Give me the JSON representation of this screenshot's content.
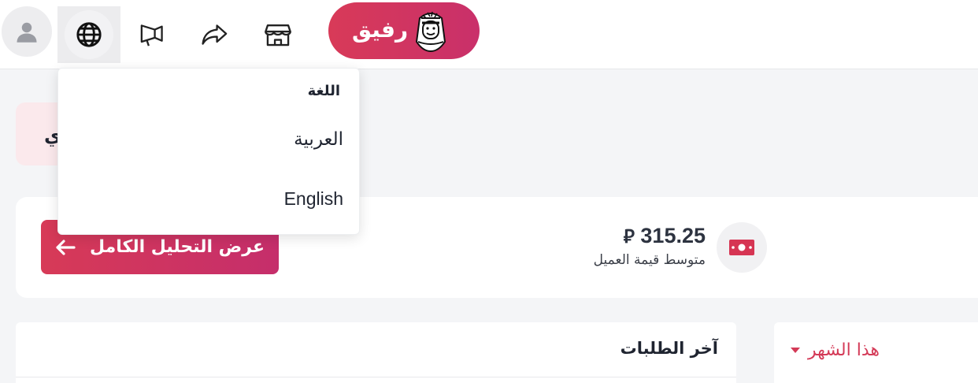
{
  "header": {
    "brand_name": "رفيق",
    "icons": {
      "avatar": "user-icon",
      "language": "globe-icon",
      "announcements": "megaphone-icon",
      "share": "share-icon",
      "store": "store-icon"
    },
    "brand_color": "#d83a58"
  },
  "language_menu": {
    "title": "اللغة",
    "options": [
      "العربية",
      "English"
    ]
  },
  "promo": {
    "visible_text": "ي"
  },
  "stats": {
    "value": "315.25",
    "currency_symbol": "⃁",
    "label": "متوسط قيمة العميل",
    "button_label": "عرض التحليل الكامل",
    "icon": "money-icon"
  },
  "orders": {
    "title": "آخر الطلبات"
  },
  "period": {
    "selected": "هذا الشهر"
  }
}
